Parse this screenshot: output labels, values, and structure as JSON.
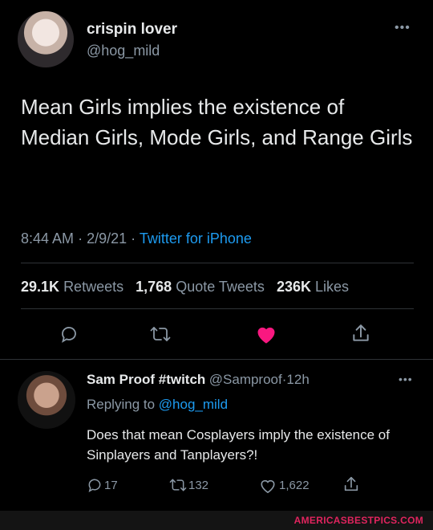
{
  "tweet": {
    "author_name": "crispin lover",
    "author_handle": "@hog_mild",
    "menu_icon": "more-dots-icon",
    "text": "Mean Girls implies the existence of Median Girls, Mode Girls, and Range Girls",
    "time": "8:44 AM",
    "date": "2/9/21",
    "source": "Twitter for iPhone",
    "separator": "·",
    "retweets_count": "29.1K",
    "retweets_label": "Retweets",
    "quotes_count": "1,768",
    "quotes_label": "Quote Tweets",
    "likes_count": "236K",
    "likes_label": "Likes",
    "actions": [
      "reply-icon",
      "retweet-icon",
      "like-icon",
      "share-icon"
    ],
    "like_color": "#f91880"
  },
  "reply": {
    "author_name": "Sam Proof #twitch",
    "author_handle": "@Samproof",
    "age": "12h",
    "separator": "·",
    "replying_prefix": "Replying to",
    "replying_to": "@hog_mild",
    "text": "Does that mean Cosplayers imply the existence of Sinplayers and Tanplayers?!",
    "reply_count": "17",
    "retweet_count": "132",
    "like_count": "1,622"
  },
  "watermark": "AMERICASBESTPICS.COM",
  "colors": {
    "background": "#000000",
    "text": "#e7e9ea",
    "secondary": "#8b98a5",
    "link": "#1d9bf0",
    "divider": "#2f3336"
  }
}
